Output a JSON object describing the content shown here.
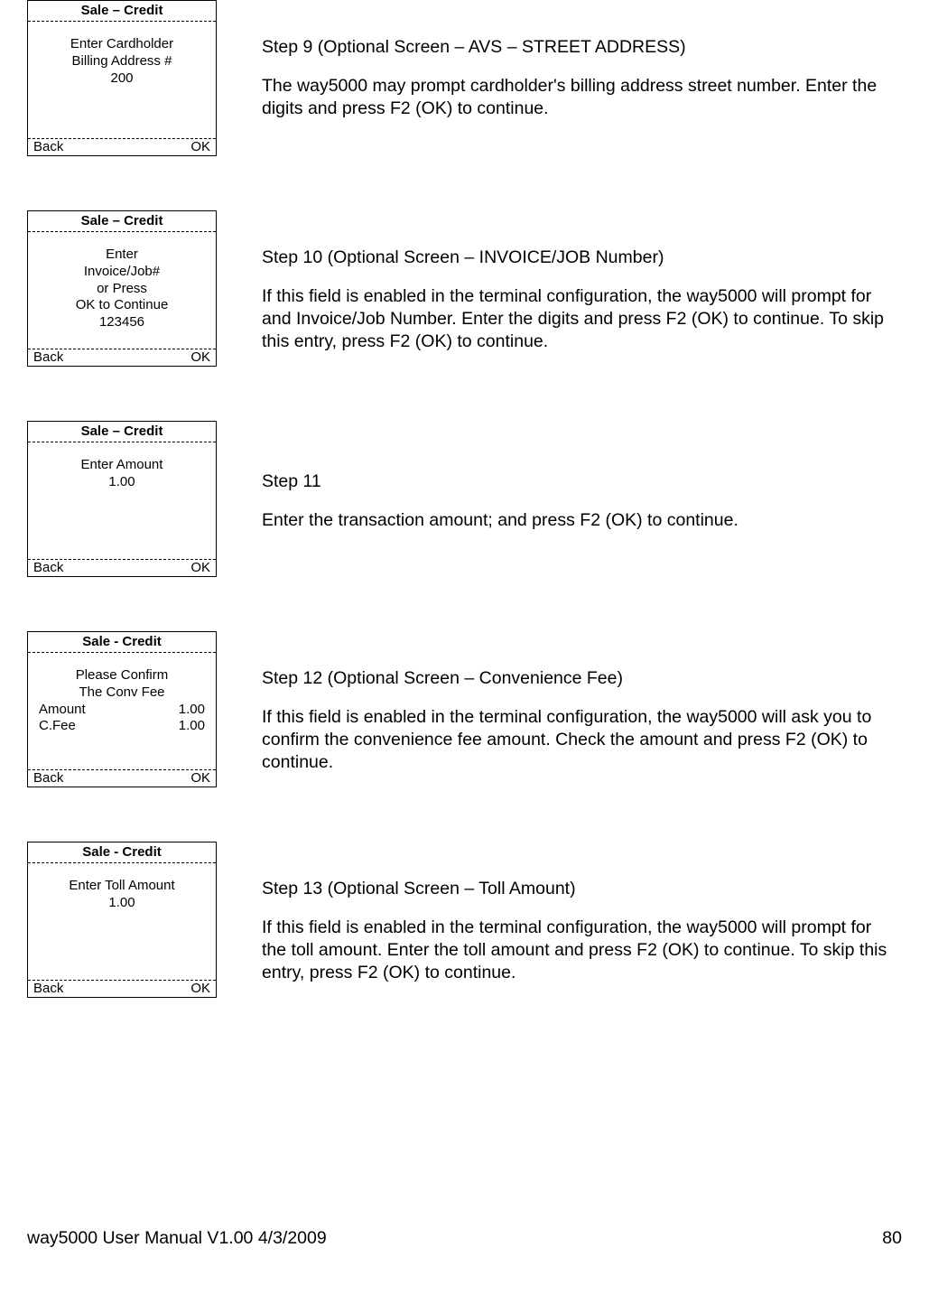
{
  "steps": [
    {
      "terminal": {
        "title": "Sale – Credit",
        "lines": [
          "Enter Cardholder",
          "Billing Address #",
          "200"
        ],
        "backLabel": "Back",
        "okLabel": "OK"
      },
      "heading": "Step 9 (Optional Screen – AVS – STREET ADDRESS)",
      "body": "The way5000 may prompt cardholder's billing address street number. Enter the digits and press F2 (OK) to continue."
    },
    {
      "terminal": {
        "title": "Sale – Credit",
        "lines": [
          "Enter",
          "Invoice/Job#",
          "or Press",
          "OK to Continue",
          "123456"
        ],
        "backLabel": "Back",
        "okLabel": "OK"
      },
      "heading": "Step 10 (Optional Screen – INVOICE/JOB Number)",
      "body": "If this field is enabled in the terminal configuration, the way5000 will prompt for and Invoice/Job Number. Enter the digits and press F2 (OK) to continue.   To skip this entry, press F2 (OK) to continue."
    },
    {
      "terminal": {
        "title": "Sale – Credit",
        "lines": [
          "Enter Amount",
          "1.00"
        ],
        "backLabel": "Back",
        "okLabel": "OK"
      },
      "heading": "Step 11",
      "body": "Enter the transaction amount; and press F2 (OK) to continue."
    },
    {
      "terminal": {
        "title": "Sale - Credit",
        "lines": [
          "Please Confirm",
          "The Conv Fee"
        ],
        "kv": [
          {
            "label": "Amount",
            "value": "1.00"
          },
          {
            "label": "C.Fee",
            "value": "1.00"
          }
        ],
        "backLabel": "Back",
        "okLabel": "OK"
      },
      "heading": "Step 12 (Optional Screen – Convenience Fee)",
      "body": "If this field is enabled in the terminal configuration, the way5000 will ask you to confirm the convenience fee amount. Check the amount and press F2 (OK) to continue."
    },
    {
      "terminal": {
        "title": "Sale - Credit",
        "lines": [
          "Enter Toll Amount",
          "1.00"
        ],
        "backLabel": "Back",
        "okLabel": "OK"
      },
      "heading": "Step 13 (Optional Screen – Toll Amount)",
      "body": "If this field is enabled in the terminal configuration, the way5000 will prompt for the toll amount. Enter the toll amount and press F2 (OK) to continue. To skip this entry, press F2 (OK) to continue."
    }
  ],
  "footer": {
    "left": "way5000 User Manual V1.00     4/3/2009",
    "right": "80"
  }
}
